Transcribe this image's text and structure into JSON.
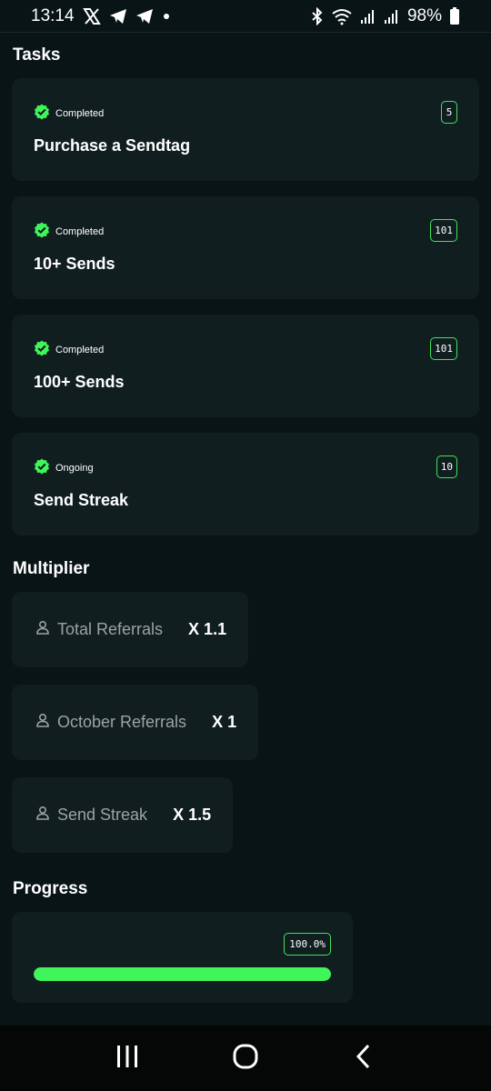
{
  "status_bar": {
    "time": "13:14",
    "battery": "98%",
    "left_icons": [
      "x-icon",
      "telegram-icon",
      "telegram-icon",
      "dot-icon"
    ],
    "right_icons": [
      "bluetooth-icon",
      "wifi-icon",
      "signal-icon",
      "signal-icon",
      "battery-icon"
    ]
  },
  "tasks": {
    "title": "Tasks",
    "items": [
      {
        "status": "Completed",
        "title": "Purchase a Sendtag",
        "badge": "5"
      },
      {
        "status": "Completed",
        "title": "10+ Sends",
        "badge": "101"
      },
      {
        "status": "Completed",
        "title": "100+ Sends",
        "badge": "101"
      },
      {
        "status": "Ongoing",
        "title": "Send Streak",
        "badge": "10"
      }
    ]
  },
  "multiplier": {
    "title": "Multiplier",
    "items": [
      {
        "label": "Total Referrals",
        "value": "X 1.1"
      },
      {
        "label": "October Referrals",
        "value": "X 1"
      },
      {
        "label": "Send Streak",
        "value": "X 1.5"
      }
    ]
  },
  "progress": {
    "title": "Progress",
    "percent_label": "100.0%",
    "fraction": 1.0
  },
  "colors": {
    "background": "#081416",
    "card": "#111e20",
    "accent_green": "#40f55a",
    "muted_text": "#9aa3a4"
  },
  "nav_bar": {
    "icons": [
      "recent-apps-icon",
      "home-icon",
      "back-icon"
    ]
  }
}
